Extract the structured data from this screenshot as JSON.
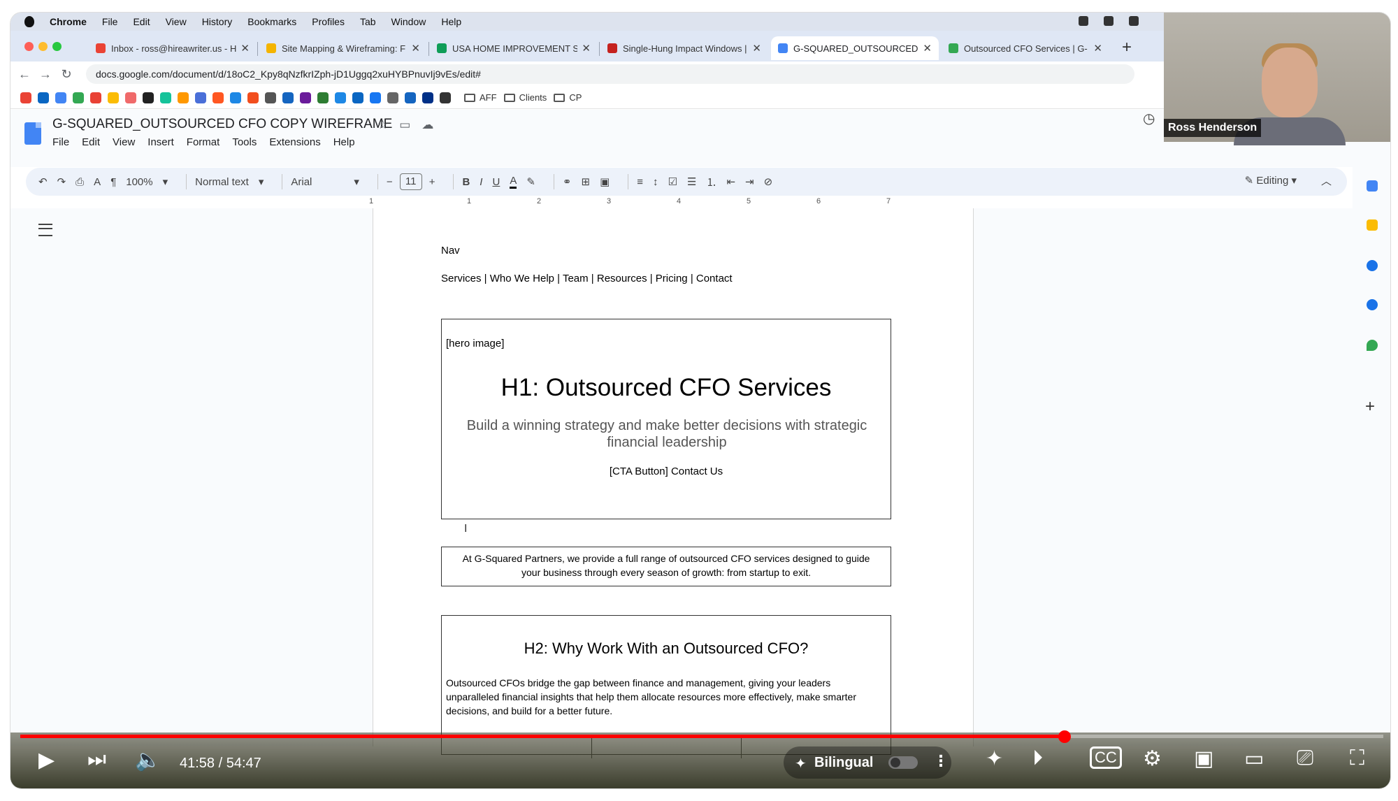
{
  "menubar": {
    "items": [
      "Chrome",
      "File",
      "Edit",
      "View",
      "History",
      "Bookmarks",
      "Profiles",
      "Tab",
      "Window",
      "Help"
    ]
  },
  "tabs": [
    {
      "label": "Inbox - ross@hireawriter.us - H",
      "favicon": "gmail",
      "color": "#ea4335"
    },
    {
      "label": "Site Mapping & Wireframing: F",
      "favicon": "slides",
      "color": "#f4b400"
    },
    {
      "label": "USA HOME IMPROVEMENT SE",
      "favicon": "sheets",
      "color": "#0f9d58"
    },
    {
      "label": "Single-Hung Impact Windows |",
      "favicon": "site",
      "color": "#c5221f"
    },
    {
      "label": "G-SQUARED_OUTSOURCED C",
      "favicon": "docs",
      "color": "#4285f4"
    },
    {
      "label": "Outsourced CFO Services | G-",
      "favicon": "site",
      "color": "#34a853"
    }
  ],
  "address": {
    "url": "docs.google.com/document/d/18oC2_Kpy8qNzfkrIZph-jD1Uggq2xuHYBPnuvIj9vEs/edit#"
  },
  "bookmarks": {
    "folders": [
      "AFF",
      "Clients",
      "CP"
    ]
  },
  "docs": {
    "title": "G-SQUARED_OUTSOURCED CFO COPY WIREFRAME",
    "menu": [
      "File",
      "Edit",
      "View",
      "Insert",
      "Format",
      "Tools",
      "Extensions",
      "Help"
    ],
    "zoom": "100%",
    "style": "Normal text",
    "font": "Arial",
    "font_size": "11",
    "mode": "Editing"
  },
  "page": {
    "nav_label": "Nav",
    "nav_links": "Services | Who We Help | Team | Resources | Pricing | Contact",
    "hero": {
      "image_placeholder": "[hero image]",
      "h1": "H1: Outsourced CFO Services",
      "sub": "Build a winning strategy and make better decisions with strategic financial leadership",
      "cta": "[CTA Button] Contact Us"
    },
    "intro": "At G-Squared Partners, we provide a full range of outsourced CFO services designed to guide your business through every season of growth: from startup to exit.",
    "section2": {
      "h2": "H2: Why Work With an Outsourced CFO?",
      "body": "Outsourced CFOs bridge the gap between finance and management, giving your leaders unparalleled financial insights that help them allocate resources more effectively, make smarter decisions, and build for a better future."
    }
  },
  "webcam": {
    "name": "Ross Henderson"
  },
  "player": {
    "time": "41:58 / 54:47",
    "progress_fraction": 0.766,
    "subtitle_mode": "Bilingual"
  }
}
